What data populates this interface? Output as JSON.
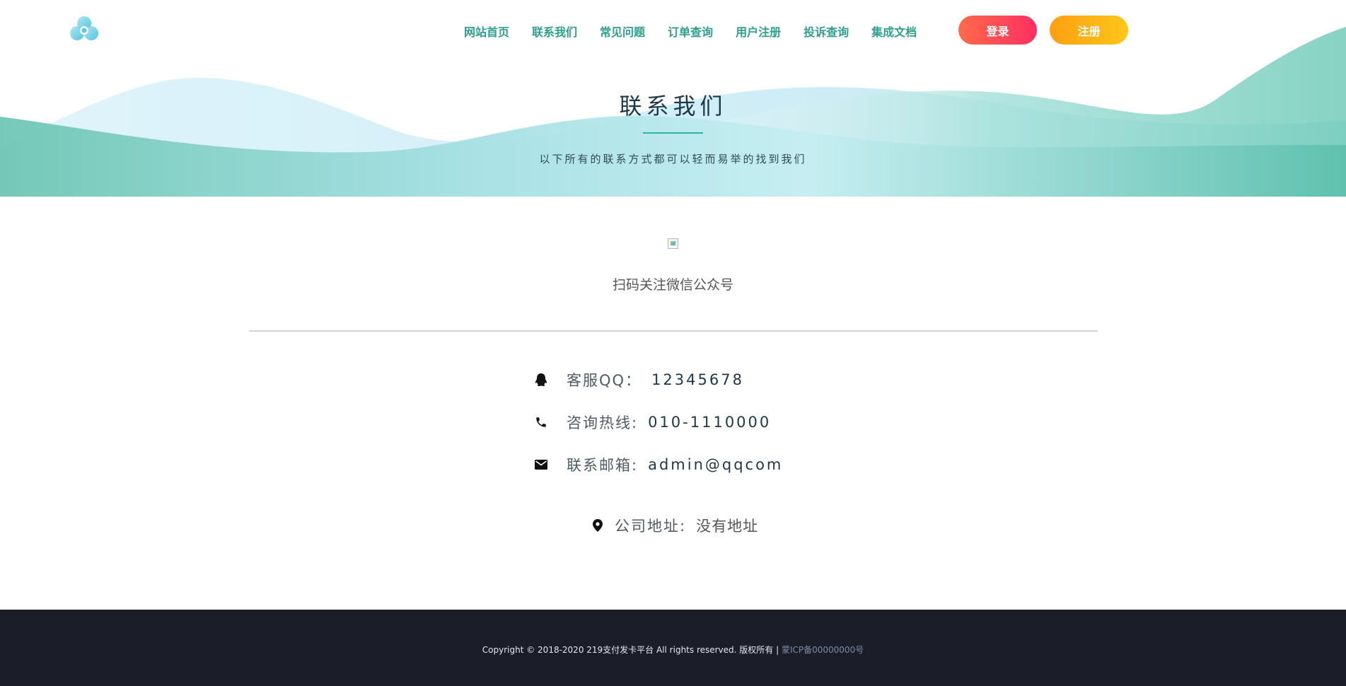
{
  "nav": {
    "items": [
      {
        "label": "网站首页"
      },
      {
        "label": "联系我们"
      },
      {
        "label": "常见问题"
      },
      {
        "label": "订单查询"
      },
      {
        "label": "用户注册"
      },
      {
        "label": "投诉查询"
      },
      {
        "label": "集成文档"
      }
    ],
    "login_label": "登录",
    "register_label": "注册"
  },
  "hero": {
    "title": "联系我们",
    "subtitle": "以下所有的联系方式都可以轻而易举的找到我们"
  },
  "qr": {
    "caption": "扫码关注微信公众号"
  },
  "contacts": {
    "qq": {
      "label": "客服QQ：",
      "value": "12345678",
      "icon": "qq-icon"
    },
    "phone": {
      "label": "咨询热线:",
      "value": "010-1110000",
      "icon": "phone-icon"
    },
    "email": {
      "label": "联系邮箱:",
      "value": "admin@qqcom",
      "icon": "mail-icon"
    },
    "address": {
      "label": "公司地址:",
      "value": "没有地址",
      "icon": "location-pin-icon"
    }
  },
  "footer": {
    "copyright": "Copyright © 2018-2020 219支付发卡平台 All rights reserved. 版权所有 | ",
    "icp": "蒙ICP备00000000号"
  },
  "colors": {
    "nav_text": "#2f9f8f",
    "login_gradient": [
      "#ff6a4a",
      "#ff2f63"
    ],
    "register_gradient": [
      "#ff9f12",
      "#ffc61a"
    ],
    "footer_bg": "#1b1e29",
    "accent": "#2bb3a3"
  }
}
